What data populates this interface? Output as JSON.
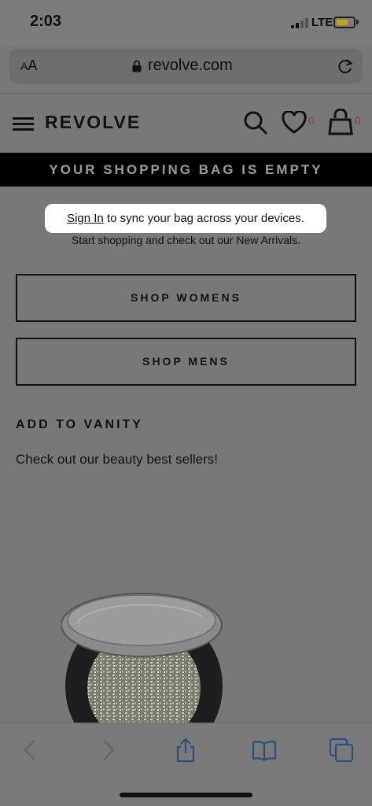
{
  "status_bar": {
    "time": "2:03",
    "network": "LTE"
  },
  "browser": {
    "text_size_label_big": "A",
    "text_size_label_small": "A",
    "url": "revolve.com"
  },
  "header": {
    "logo": "REVOLVE",
    "wishlist_count": "0",
    "bag_count": "0"
  },
  "banner": {
    "text": "YOUR SHOPPING BAG IS EMPTY"
  },
  "signin": {
    "link": "Sign In",
    "rest": " to sync your bag across your devices."
  },
  "subtext": "Start shopping and check out our New Arrivals.",
  "buttons": {
    "shop_womens": "SHOP WOMENS",
    "shop_mens": "SHOP MENS"
  },
  "vanity": {
    "title": "ADD TO VANITY",
    "subtitle": "Check out our beauty best sellers!"
  },
  "colors": {
    "accent_count": "#8a3a55",
    "banner_bg": "#000000",
    "battery": "#c9a412",
    "toolbar_icon": "#2b4f86"
  }
}
